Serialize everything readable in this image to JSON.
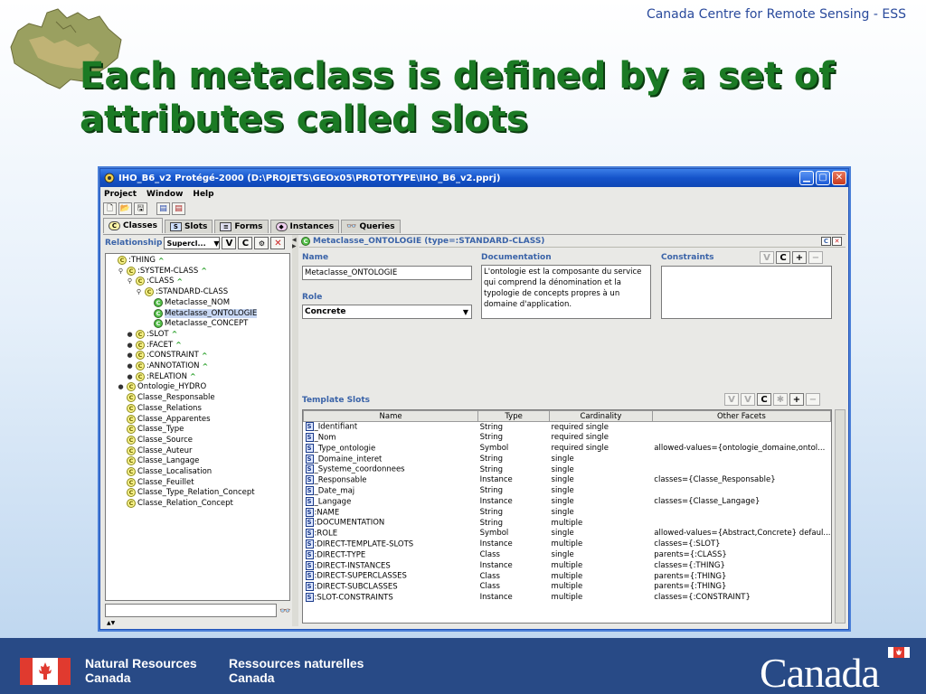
{
  "header": {
    "org": "Canada Centre for Remote Sensing - ESS"
  },
  "slide": {
    "title_line1": "Each metaclass is defined by a set of",
    "title_line2": "attributes called slots"
  },
  "window": {
    "title": "IHO_B6_v2  Protégé-2000    (D:\\PROJETS\\GEOx05\\PROTOTYPE\\IHO_B6_v2.pprj)",
    "menu": [
      "Project",
      "Window",
      "Help"
    ],
    "tabs": [
      "Classes",
      "Slots",
      "Forms",
      "Instances",
      "Queries"
    ]
  },
  "left_pane": {
    "relationship_label": "Relationship",
    "relationship_value": "Supercl...",
    "buttons": [
      "V",
      "C"
    ],
    "tree": [
      {
        "label": ":THING",
        "hat": "^",
        "depth": 0,
        "toggle": "",
        "icon": "yellow"
      },
      {
        "label": ":SYSTEM-CLASS",
        "hat": "^",
        "depth": 1,
        "toggle": "⚲",
        "icon": "yellow"
      },
      {
        "label": ":CLASS",
        "hat": "^",
        "depth": 2,
        "toggle": "⚲",
        "icon": "yellow"
      },
      {
        "label": ":STANDARD-CLASS",
        "hat": "",
        "depth": 3,
        "toggle": "⚲",
        "icon": "yellow"
      },
      {
        "label": "Metaclasse_NOM",
        "hat": "",
        "depth": 4,
        "toggle": "",
        "icon": "green"
      },
      {
        "label": "Metaclasse_ONTOLOGIE",
        "hat": "",
        "depth": 4,
        "toggle": "",
        "icon": "green",
        "selected": true
      },
      {
        "label": "Metaclasse_CONCEPT",
        "hat": "",
        "depth": 4,
        "toggle": "",
        "icon": "green"
      },
      {
        "label": ":SLOT",
        "hat": "^",
        "depth": 2,
        "toggle": "⚬",
        "icon": "yellow"
      },
      {
        "label": ":FACET",
        "hat": "^",
        "depth": 2,
        "toggle": "⚬",
        "icon": "yellow"
      },
      {
        "label": ":CONSTRAINT",
        "hat": "^",
        "depth": 2,
        "toggle": "⚬",
        "icon": "yellow"
      },
      {
        "label": ":ANNOTATION",
        "hat": "^",
        "depth": 2,
        "toggle": "⚬",
        "icon": "yellow"
      },
      {
        "label": ":RELATION",
        "hat": "^",
        "depth": 2,
        "toggle": "⚬",
        "icon": "yellow"
      },
      {
        "label": "Ontologie_HYDRO",
        "hat": "",
        "depth": 1,
        "toggle": "⚬",
        "icon": "yellow"
      },
      {
        "label": "Classe_Responsable",
        "hat": "",
        "depth": 1,
        "toggle": "",
        "icon": "yellow"
      },
      {
        "label": "Classe_Relations",
        "hat": "",
        "depth": 1,
        "toggle": "",
        "icon": "yellow"
      },
      {
        "label": "Classe_Apparentes",
        "hat": "",
        "depth": 1,
        "toggle": "",
        "icon": "yellow"
      },
      {
        "label": "Classe_Type",
        "hat": "",
        "depth": 1,
        "toggle": "",
        "icon": "yellow"
      },
      {
        "label": "Classe_Source",
        "hat": "",
        "depth": 1,
        "toggle": "",
        "icon": "yellow"
      },
      {
        "label": "Classe_Auteur",
        "hat": "",
        "depth": 1,
        "toggle": "",
        "icon": "yellow"
      },
      {
        "label": "Classe_Langage",
        "hat": "",
        "depth": 1,
        "toggle": "",
        "icon": "yellow"
      },
      {
        "label": "Classe_Localisation",
        "hat": "",
        "depth": 1,
        "toggle": "",
        "icon": "yellow"
      },
      {
        "label": "Classe_Feuillet",
        "hat": "",
        "depth": 1,
        "toggle": "",
        "icon": "yellow"
      },
      {
        "label": "Classe_Type_Relation_Concept",
        "hat": "",
        "depth": 1,
        "toggle": "",
        "icon": "yellow"
      },
      {
        "label": "Classe_Relation_Concept",
        "hat": "",
        "depth": 1,
        "toggle": "",
        "icon": "yellow"
      }
    ]
  },
  "right_pane": {
    "header": "Metaclasse_ONTOLOGIE    (type=:STANDARD-CLASS)",
    "name_label": "Name",
    "name_value": "Metaclasse_ONTOLOGIE",
    "doc_label": "Documentation",
    "doc_value": "L'ontologie est la composante du service qui comprend la dénomination et la typologie de concepts propres à un domaine d'application.",
    "constraints_label": "Constraints",
    "role_label": "Role",
    "role_value": "Concrete",
    "template_slots_label": "Template Slots",
    "columns": [
      "Name",
      "Type",
      "Cardinality",
      "Other Facets"
    ],
    "rows": [
      {
        "name": "_Identifiant",
        "type": "String",
        "card": "required single",
        "facets": ""
      },
      {
        "name": "_Nom",
        "type": "String",
        "card": "required single",
        "facets": ""
      },
      {
        "name": "_Type_ontologie",
        "type": "Symbol",
        "card": "required single",
        "facets": "allowed-values={ontologie_domaine,ontol..."
      },
      {
        "name": "_Domaine_interet",
        "type": "String",
        "card": "single",
        "facets": ""
      },
      {
        "name": "_Systeme_coordonnees",
        "type": "String",
        "card": "single",
        "facets": ""
      },
      {
        "name": "_Responsable",
        "type": "Instance",
        "card": "single",
        "facets": "classes={Classe_Responsable}"
      },
      {
        "name": "_Date_maj",
        "type": "String",
        "card": "single",
        "facets": ""
      },
      {
        "name": "_Langage",
        "type": "Instance",
        "card": "single",
        "facets": "classes={Classe_Langage}"
      },
      {
        "name": ":NAME",
        "type": "String",
        "card": "single",
        "facets": ""
      },
      {
        "name": ":DOCUMENTATION",
        "type": "String",
        "card": "multiple",
        "facets": ""
      },
      {
        "name": ":ROLE",
        "type": "Symbol",
        "card": "single",
        "facets": "allowed-values={Abstract,Concrete} defaul..."
      },
      {
        "name": ":DIRECT-TEMPLATE-SLOTS",
        "type": "Instance",
        "card": "multiple",
        "facets": "classes={:SLOT}"
      },
      {
        "name": ":DIRECT-TYPE",
        "type": "Class",
        "card": "single",
        "facets": "parents={:CLASS}"
      },
      {
        "name": ":DIRECT-INSTANCES",
        "type": "Instance",
        "card": "multiple",
        "facets": "classes={:THING}"
      },
      {
        "name": ":DIRECT-SUPERCLASSES",
        "type": "Class",
        "card": "multiple",
        "facets": "parents={:THING}"
      },
      {
        "name": ":DIRECT-SUBCLASSES",
        "type": "Class",
        "card": "multiple",
        "facets": "parents={:THING}"
      },
      {
        "name": ":SLOT-CONSTRAINTS",
        "type": "Instance",
        "card": "multiple",
        "facets": "classes={:CONSTRAINT}"
      }
    ]
  },
  "footer": {
    "nr_en_1": "Natural Resources",
    "nr_en_2": "Canada",
    "nr_fr_1": "Ressources naturelles",
    "nr_fr_2": "Canada",
    "wordmark": "Canada"
  },
  "colors": {
    "title_green": "#1b7a24",
    "footer_blue": "#284a86",
    "xp_blue": "#1553c9"
  }
}
